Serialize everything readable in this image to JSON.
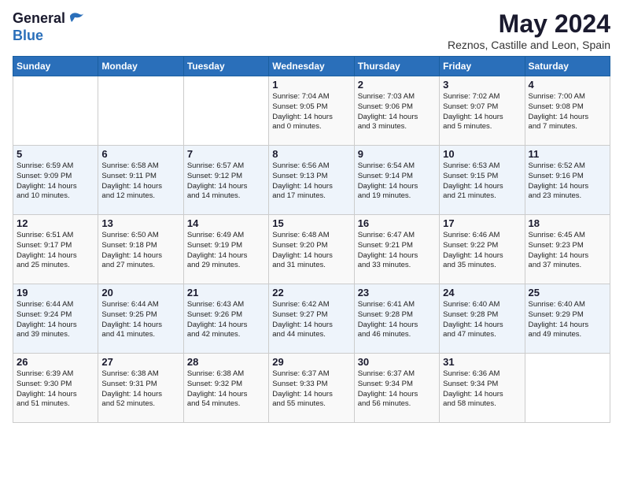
{
  "logo": {
    "line1": "General",
    "line2": "Blue"
  },
  "header": {
    "title": "May 2024",
    "subtitle": "Reznos, Castille and Leon, Spain"
  },
  "weekdays": [
    "Sunday",
    "Monday",
    "Tuesday",
    "Wednesday",
    "Thursday",
    "Friday",
    "Saturday"
  ],
  "weeks": [
    [
      {
        "day": "",
        "info": ""
      },
      {
        "day": "",
        "info": ""
      },
      {
        "day": "",
        "info": ""
      },
      {
        "day": "1",
        "info": "Sunrise: 7:04 AM\nSunset: 9:05 PM\nDaylight: 14 hours\nand 0 minutes."
      },
      {
        "day": "2",
        "info": "Sunrise: 7:03 AM\nSunset: 9:06 PM\nDaylight: 14 hours\nand 3 minutes."
      },
      {
        "day": "3",
        "info": "Sunrise: 7:02 AM\nSunset: 9:07 PM\nDaylight: 14 hours\nand 5 minutes."
      },
      {
        "day": "4",
        "info": "Sunrise: 7:00 AM\nSunset: 9:08 PM\nDaylight: 14 hours\nand 7 minutes."
      }
    ],
    [
      {
        "day": "5",
        "info": "Sunrise: 6:59 AM\nSunset: 9:09 PM\nDaylight: 14 hours\nand 10 minutes."
      },
      {
        "day": "6",
        "info": "Sunrise: 6:58 AM\nSunset: 9:11 PM\nDaylight: 14 hours\nand 12 minutes."
      },
      {
        "day": "7",
        "info": "Sunrise: 6:57 AM\nSunset: 9:12 PM\nDaylight: 14 hours\nand 14 minutes."
      },
      {
        "day": "8",
        "info": "Sunrise: 6:56 AM\nSunset: 9:13 PM\nDaylight: 14 hours\nand 17 minutes."
      },
      {
        "day": "9",
        "info": "Sunrise: 6:54 AM\nSunset: 9:14 PM\nDaylight: 14 hours\nand 19 minutes."
      },
      {
        "day": "10",
        "info": "Sunrise: 6:53 AM\nSunset: 9:15 PM\nDaylight: 14 hours\nand 21 minutes."
      },
      {
        "day": "11",
        "info": "Sunrise: 6:52 AM\nSunset: 9:16 PM\nDaylight: 14 hours\nand 23 minutes."
      }
    ],
    [
      {
        "day": "12",
        "info": "Sunrise: 6:51 AM\nSunset: 9:17 PM\nDaylight: 14 hours\nand 25 minutes."
      },
      {
        "day": "13",
        "info": "Sunrise: 6:50 AM\nSunset: 9:18 PM\nDaylight: 14 hours\nand 27 minutes."
      },
      {
        "day": "14",
        "info": "Sunrise: 6:49 AM\nSunset: 9:19 PM\nDaylight: 14 hours\nand 29 minutes."
      },
      {
        "day": "15",
        "info": "Sunrise: 6:48 AM\nSunset: 9:20 PM\nDaylight: 14 hours\nand 31 minutes."
      },
      {
        "day": "16",
        "info": "Sunrise: 6:47 AM\nSunset: 9:21 PM\nDaylight: 14 hours\nand 33 minutes."
      },
      {
        "day": "17",
        "info": "Sunrise: 6:46 AM\nSunset: 9:22 PM\nDaylight: 14 hours\nand 35 minutes."
      },
      {
        "day": "18",
        "info": "Sunrise: 6:45 AM\nSunset: 9:23 PM\nDaylight: 14 hours\nand 37 minutes."
      }
    ],
    [
      {
        "day": "19",
        "info": "Sunrise: 6:44 AM\nSunset: 9:24 PM\nDaylight: 14 hours\nand 39 minutes."
      },
      {
        "day": "20",
        "info": "Sunrise: 6:44 AM\nSunset: 9:25 PM\nDaylight: 14 hours\nand 41 minutes."
      },
      {
        "day": "21",
        "info": "Sunrise: 6:43 AM\nSunset: 9:26 PM\nDaylight: 14 hours\nand 42 minutes."
      },
      {
        "day": "22",
        "info": "Sunrise: 6:42 AM\nSunset: 9:27 PM\nDaylight: 14 hours\nand 44 minutes."
      },
      {
        "day": "23",
        "info": "Sunrise: 6:41 AM\nSunset: 9:28 PM\nDaylight: 14 hours\nand 46 minutes."
      },
      {
        "day": "24",
        "info": "Sunrise: 6:40 AM\nSunset: 9:28 PM\nDaylight: 14 hours\nand 47 minutes."
      },
      {
        "day": "25",
        "info": "Sunrise: 6:40 AM\nSunset: 9:29 PM\nDaylight: 14 hours\nand 49 minutes."
      }
    ],
    [
      {
        "day": "26",
        "info": "Sunrise: 6:39 AM\nSunset: 9:30 PM\nDaylight: 14 hours\nand 51 minutes."
      },
      {
        "day": "27",
        "info": "Sunrise: 6:38 AM\nSunset: 9:31 PM\nDaylight: 14 hours\nand 52 minutes."
      },
      {
        "day": "28",
        "info": "Sunrise: 6:38 AM\nSunset: 9:32 PM\nDaylight: 14 hours\nand 54 minutes."
      },
      {
        "day": "29",
        "info": "Sunrise: 6:37 AM\nSunset: 9:33 PM\nDaylight: 14 hours\nand 55 minutes."
      },
      {
        "day": "30",
        "info": "Sunrise: 6:37 AM\nSunset: 9:34 PM\nDaylight: 14 hours\nand 56 minutes."
      },
      {
        "day": "31",
        "info": "Sunrise: 6:36 AM\nSunset: 9:34 PM\nDaylight: 14 hours\nand 58 minutes."
      },
      {
        "day": "",
        "info": ""
      }
    ]
  ]
}
